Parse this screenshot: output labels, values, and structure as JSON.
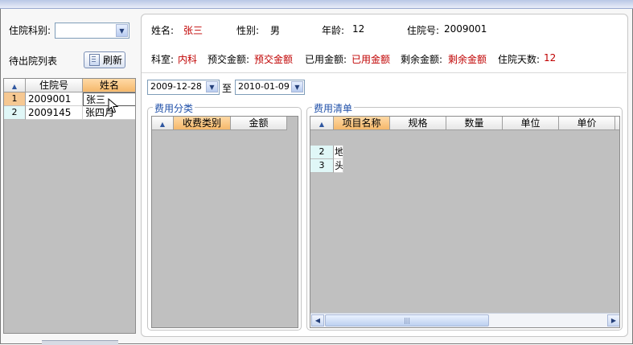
{
  "patient": {
    "name_label": "姓名:",
    "name_value": "张三",
    "gender_label": "性别:",
    "gender_value": "男",
    "age_label": "年龄:",
    "age_value": "12",
    "admission_no_label": "住院号:",
    "admission_no_value": "2009001",
    "dept_label": "科室:",
    "dept_value": "内科",
    "prepaid_label": "预交金额:",
    "prepaid_value": "预交金额",
    "used_label": "已用金额:",
    "used_value": "已用金额",
    "remaining_label": "剩余金额:",
    "remaining_value": "剩余金额",
    "days_label": "住院天数:",
    "days_value": "12"
  },
  "left": {
    "dept_label": "住院科别:",
    "dept_select_value": "",
    "list_label": "待出院列表",
    "refresh_label": "刷新",
    "columns": [
      "住院号",
      "姓名"
    ],
    "rows": [
      {
        "num": "1",
        "id": "2009001",
        "name": "张三"
      },
      {
        "num": "2",
        "id": "2009145",
        "name": "张四月"
      }
    ]
  },
  "dates": {
    "from": "2009-12-28",
    "to_label": "至",
    "to": "2010-01-09"
  },
  "fee_category": {
    "title": "费用分类",
    "columns": [
      "收费类别",
      "金额"
    ]
  },
  "fee_list": {
    "title": "费用清单",
    "columns": [
      "项目名称",
      "规格",
      "数量",
      "单位",
      "单价"
    ],
    "rows": [
      {
        "num": "2",
        "item": "地"
      },
      {
        "num": "3",
        "item": "头"
      }
    ]
  },
  "colors": {
    "accent_red": "#c00000",
    "legend_blue": "#1f4fa8",
    "header_orange": "#f5b86a",
    "grid_gray": "#c0c0c0"
  }
}
